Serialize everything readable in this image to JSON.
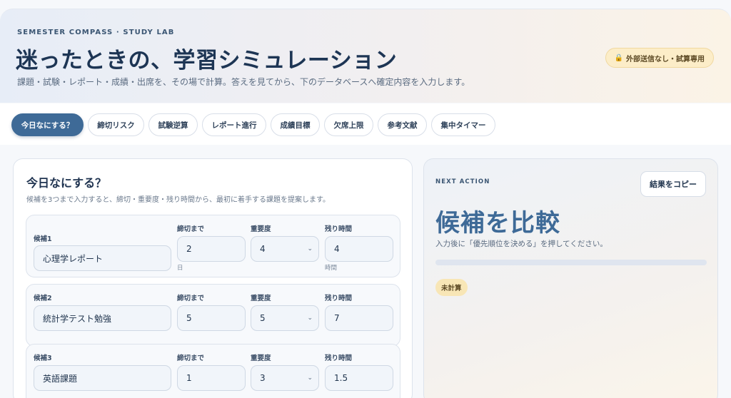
{
  "header": {
    "eyebrow": "SEMESTER COMPASS · STUDY LAB",
    "title": "迷ったときの、学習シミュレーション",
    "subtitle": "課題・試験・レポート・成績・出席を、その場で計算。答えを見てから、下のデータベースへ確定内容を入力します。",
    "badge": "外部送信なし・試算専用",
    "badge_icon": "lock-icon"
  },
  "tabs": [
    {
      "label": "今日なにする？",
      "active": true
    },
    {
      "label": "締切リスク",
      "active": false
    },
    {
      "label": "試験逆算",
      "active": false
    },
    {
      "label": "レポート進行",
      "active": false
    },
    {
      "label": "成績目標",
      "active": false
    },
    {
      "label": "欠席上限",
      "active": false
    },
    {
      "label": "参考文献",
      "active": false
    },
    {
      "label": "集中タイマー",
      "active": false
    }
  ],
  "planner": {
    "title": "今日なにする？",
    "description": "候補を3つまで入力すると、締切・重要度・残り時間から、最初に着手する課題を提案します。",
    "col_deadline": "締切まで",
    "col_importance": "重要度",
    "col_remaining": "残り時間",
    "unit_days": "日",
    "unit_hours": "時間",
    "candidates": [
      {
        "label": "候補1",
        "name": "心理学レポート",
        "deadline": "2",
        "importance": "4",
        "remaining": "4"
      },
      {
        "label": "候補2",
        "name": "統計学テスト勉強",
        "deadline": "5",
        "importance": "5",
        "remaining": "7"
      },
      {
        "label": "候補3",
        "name": "英語課題",
        "deadline": "1",
        "importance": "3",
        "remaining": "1.5"
      }
    ]
  },
  "result": {
    "eyebrow": "NEXT ACTION",
    "copy_label": "結果をコピー",
    "headline": "候補を比較",
    "hint": "入力後に「優先順位を決める」を押してください。",
    "progress": 0,
    "status": "未計算"
  },
  "colors": {
    "accent": "#3e6a97",
    "badge_bg": "#fcedc8",
    "status_bg": "#f8e6b6"
  }
}
